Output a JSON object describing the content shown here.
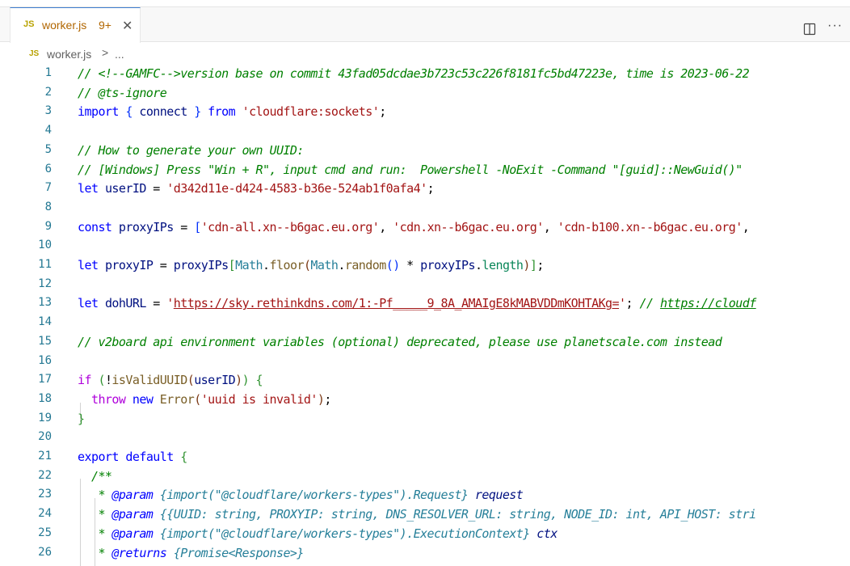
{
  "tab": {
    "icon": "JS",
    "name": "worker.js",
    "badge": "9+",
    "close": "✕"
  },
  "toolbar": {
    "split_icon": "split-editor-icon",
    "more": "···"
  },
  "breadcrumb": {
    "icon": "JS",
    "file": "worker.js",
    "sep": ">",
    "more": "..."
  },
  "colors": {
    "accent": "#3e7ed1",
    "tab_text": "#b16600",
    "line_number": "#237893",
    "comment": "#008000",
    "keyword": "#0000ff",
    "string": "#a31515",
    "variable": "#001080"
  },
  "lines": [
    {
      "n": "1",
      "text": "// <!--GAMFC-->version base on commit 43fad05dcdae3b723c53c226f8181fc5bd47223e, time is 2023-06-22"
    },
    {
      "n": "2",
      "text": "// @ts-ignore"
    },
    {
      "n": "3",
      "text": "import { connect } from 'cloudflare:sockets';"
    },
    {
      "n": "4",
      "text": ""
    },
    {
      "n": "5",
      "text": "// How to generate your own UUID:"
    },
    {
      "n": "6",
      "text": "// [Windows] Press \"Win + R\", input cmd and run:  Powershell -NoExit -Command \"[guid]::NewGuid()\""
    },
    {
      "n": "7",
      "text": "let userID = 'd342d11e-d424-4583-b36e-524ab1f0afa4';"
    },
    {
      "n": "8",
      "text": ""
    },
    {
      "n": "9",
      "text": "const proxyIPs = ['cdn-all.xn--b6gac.eu.org', 'cdn.xn--b6gac.eu.org', 'cdn-b100.xn--b6gac.eu.org',"
    },
    {
      "n": "10",
      "text": ""
    },
    {
      "n": "11",
      "text": "let proxyIP = proxyIPs[Math.floor(Math.random() * proxyIPs.length)];"
    },
    {
      "n": "12",
      "text": ""
    },
    {
      "n": "13",
      "text": "let dohURL = 'https://sky.rethinkdns.com/1:-Pf_____9_8A_AMAIgE8kMABVDDmKOHTAKg='; // https://cloudf"
    },
    {
      "n": "14",
      "text": ""
    },
    {
      "n": "15",
      "text": "// v2board api environment variables (optional) deprecated, please use planetscale.com instead"
    },
    {
      "n": "16",
      "text": ""
    },
    {
      "n": "17",
      "text": "if (!isValidUUID(userID)) {"
    },
    {
      "n": "18",
      "text": "  throw new Error('uuid is invalid');"
    },
    {
      "n": "19",
      "text": "}"
    },
    {
      "n": "20",
      "text": ""
    },
    {
      "n": "21",
      "text": "export default {"
    },
    {
      "n": "22",
      "text": "  /**"
    },
    {
      "n": "23",
      "text": "   * @param {import(\"@cloudflare/workers-types\").Request} request"
    },
    {
      "n": "24",
      "text": "   * @param {{UUID: string, PROXYIP: string, DNS_RESOLVER_URL: string, NODE_ID: int, API_HOST: stri"
    },
    {
      "n": "25",
      "text": "   * @param {import(\"@cloudflare/workers-types\").ExecutionContext} ctx"
    },
    {
      "n": "26",
      "text": "   * @returns {Promise<Response>}"
    }
  ]
}
